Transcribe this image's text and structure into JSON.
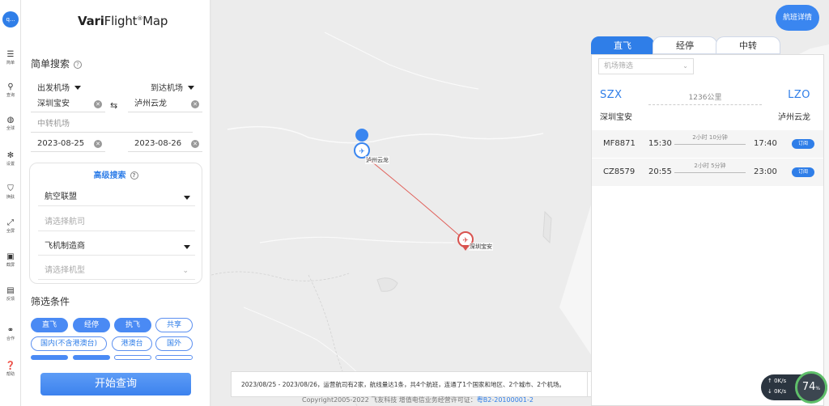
{
  "rail": {
    "avatar_text": "q...",
    "items": [
      {
        "icon": "menu-icon",
        "label": "简单"
      },
      {
        "icon": "search-icon",
        "label": "查询"
      },
      {
        "icon": "globe-icon",
        "label": "全球"
      },
      {
        "icon": "gear-icon",
        "label": "设置"
      },
      {
        "icon": "shirt-icon",
        "label": "换肤"
      },
      {
        "icon": "fullscreen-icon",
        "label": "全屏"
      },
      {
        "icon": "screenshot-icon",
        "label": "截屏"
      },
      {
        "icon": "feedback-icon",
        "label": "反馈"
      },
      {
        "icon": "handshake-icon",
        "label": "合作"
      },
      {
        "icon": "help-icon",
        "label": "帮助"
      }
    ]
  },
  "logo": {
    "bold": "Vari",
    "rest": "Flight",
    "sup": "®",
    "tail": "Map"
  },
  "simple_search": {
    "title": "简单搜索",
    "dep_label": "出发机场",
    "arr_label": "到达机场",
    "dep_value": "深圳宝安",
    "arr_value": "泸州云龙",
    "transfer_placeholder": "中转机场",
    "date_from": "2023-08-25",
    "date_to": "2023-08-26"
  },
  "advanced": {
    "title": "高级搜索",
    "alliance": "航空联盟",
    "airline_placeholder": "请选择航司",
    "manufacturer": "飞机制造商",
    "model_placeholder": "请选择机型"
  },
  "filters": {
    "title": "筛选条件",
    "row1": [
      "直飞",
      "经停",
      "执飞",
      "共享"
    ],
    "row2": [
      "国内(不含港澳台)",
      "港澳台",
      "国外"
    ]
  },
  "search_button": "开始查询",
  "map": {
    "origin_label": "深圳宝安",
    "dest_label": "泸州云龙",
    "notice_text": "2023/08/25 - 2023/08/26，运营航司有2家，航线量达1条，共4个航班，连通了1个国家和地区、2个城市、2个机场。",
    "notice_close": "✕",
    "copyright": "Copyright2005-2022 飞友科技 增值电信业务经营许可证：",
    "license": "粤B2-20100001-2",
    "colors": {
      "route": "#e0605a",
      "origin_pin": "#d9534f",
      "dest_pin": "#3a86f0"
    }
  },
  "flight_detail_button": "航班详情",
  "flight_panel": {
    "tabs": [
      "直飞",
      "经停",
      "中转"
    ],
    "active_tab": "直飞",
    "airport_filter_placeholder": "机场筛选",
    "from_code": "SZX",
    "to_code": "LZO",
    "distance": "1236公里",
    "from_city": "深圳宝安",
    "to_city": "泸州云龙",
    "flights": [
      {
        "no": "MF8871",
        "dep": "15:30",
        "duration": "2小时 10分钟",
        "arr": "17:40",
        "action": "订阅"
      },
      {
        "no": "CZ8579",
        "dep": "20:55",
        "duration": "2小时 5分钟",
        "arr": "23:00",
        "action": "订阅"
      }
    ]
  },
  "speed_widget": {
    "up": "0K/s",
    "down": "0K/s",
    "percent": "74",
    "unit": "%"
  }
}
